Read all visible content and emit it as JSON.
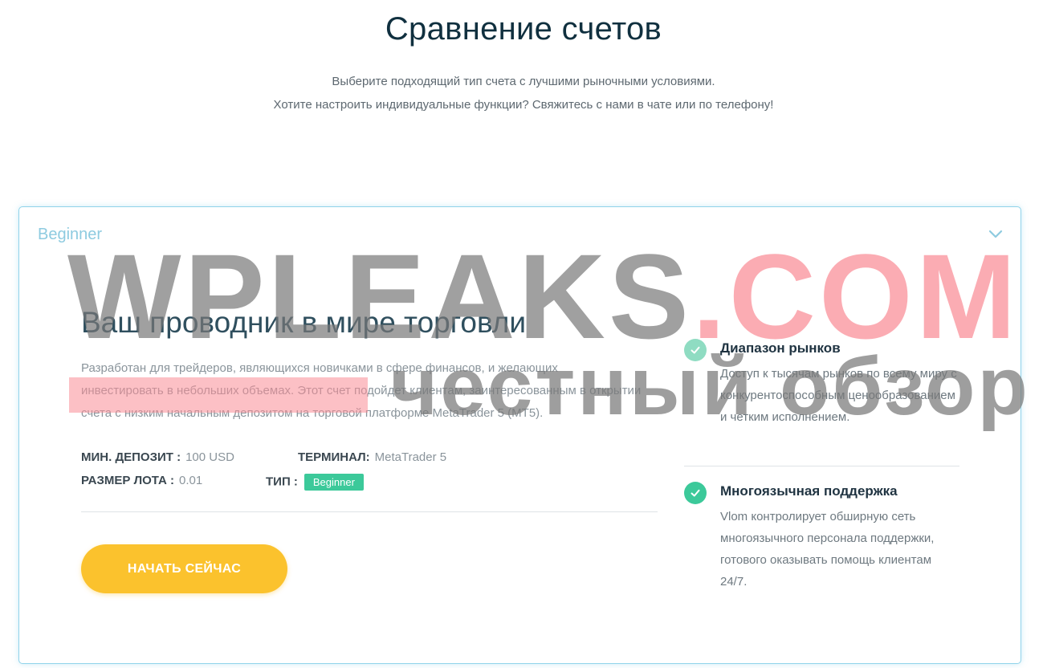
{
  "page": {
    "title": "Сравнение счетов",
    "subtitle_line1": "Выберите подходящий тип счета с лучшими рыночными условиями.",
    "subtitle_line2": "Хотите настроить индивидуальные функции? Свяжитесь с нами в чате или по телефону!"
  },
  "account_card": {
    "header_label": "Beginner",
    "chevron_icon": "chevron-down-icon",
    "heading": "Ваш проводник в мире торговли",
    "description": "Разработан для трейдеров, являющихся новичками в сфере финансов, и желающих инвестировать в небольших объемах. Этот счет подойдет клиентам, заинтересованным в открытии счета с низким начальным депозитом на торговой платформе MetaTrader 5 (MT5).",
    "specs": {
      "min_deposit_label": "МИН. ДЕПОЗИТ :",
      "min_deposit_value": "100 USD",
      "terminal_label": "ТЕРМИНАЛ:",
      "terminal_value": "MetaTrader 5",
      "lot_size_label": "РАЗМЕР ЛОТА :",
      "lot_size_value": "0.01",
      "type_label": "ТИП :",
      "type_value": "Beginner"
    },
    "cta_label": "НАЧАТЬ СЕЙЧАС",
    "features": [
      {
        "icon": "check-circle-icon",
        "title": "Диапазон рынков",
        "text": "Доступ к тысячам рынков по всему миру с конкурентоспособным ценообразованием и четким исполнением."
      },
      {
        "icon": "check-circle-icon",
        "title": "Многоязычная поддержка",
        "text": "Vlom контролирует обширную сеть многоязычного персонала поддержки, готового оказывать помощь клиентам 24/7."
      }
    ]
  },
  "watermark": {
    "main": "WPLEAKS",
    "dot_com": ".COM",
    "sub": "честный обзор"
  },
  "colors": {
    "accent_green": "#3cc99a",
    "cta_yellow": "#fbc22d",
    "card_border": "#8fd3ea",
    "title_dark": "#10303f"
  }
}
